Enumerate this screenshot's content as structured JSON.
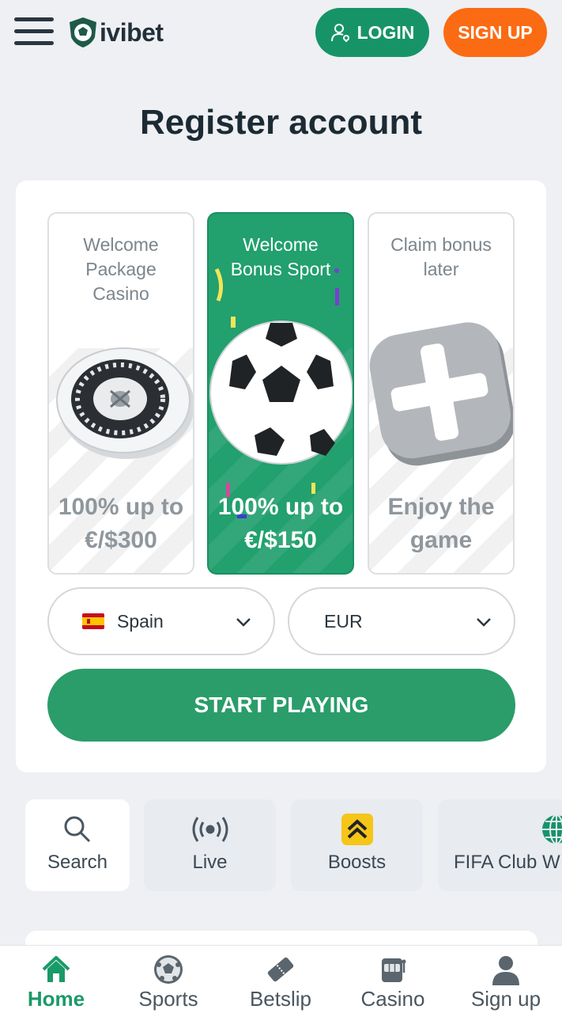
{
  "header": {
    "logo_text": "ivibet",
    "login_label": "LOGIN",
    "signup_label": "SIGN UP"
  },
  "page": {
    "title": "Register account"
  },
  "bonuses": [
    {
      "title": "Welcome Package Casino",
      "value": "100% up to €/$300",
      "selected": false,
      "art": "roulette-wheel"
    },
    {
      "title": "Welcome Bonus Sport",
      "value": "100% up to €/$150",
      "selected": true,
      "art": "soccer-ball"
    },
    {
      "title": "Claim bonus later",
      "value": "Enjoy the game",
      "selected": false,
      "art": "close-x-tile"
    }
  ],
  "form": {
    "country": "Spain",
    "currency": "EUR",
    "start_label": "START PLAYING"
  },
  "quick_nav": [
    {
      "label": "Search",
      "icon": "search-icon"
    },
    {
      "label": "Live",
      "icon": "live-broadcast-icon"
    },
    {
      "label": "Boosts",
      "icon": "boost-icon"
    },
    {
      "label": "FIFA Club W",
      "icon": "globe-icon"
    }
  ],
  "bottom_nav": [
    {
      "label": "Home",
      "icon": "home-icon",
      "active": true
    },
    {
      "label": "Sports",
      "icon": "soccer-ball-icon",
      "active": false
    },
    {
      "label": "Betslip",
      "icon": "ticket-icon",
      "active": false
    },
    {
      "label": "Casino",
      "icon": "slot-machine-icon",
      "active": false
    },
    {
      "label": "Sign up",
      "icon": "user-icon",
      "active": false
    }
  ],
  "colors": {
    "brand_green": "#169468",
    "signup_orange": "#fb6b13",
    "start_green": "#2a9d6a",
    "selected_card": "#22a06e"
  }
}
